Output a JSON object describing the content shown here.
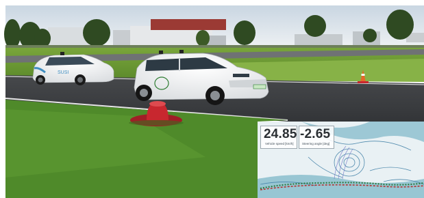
{
  "overlay": {
    "speed": {
      "value": "24.85",
      "label": "Vehicle speed [km/h]"
    },
    "steering": {
      "value": "-2.65",
      "label": "Steering angle [deg]"
    }
  },
  "colors": {
    "sky": "#dfe6ec",
    "grass": "#6c9a34",
    "asphalt": "#3b3d40",
    "car_white": "#f2f3f4",
    "cone_red": "#c8272f",
    "overlay_blue": "#8fc1cf",
    "trajectory_red": "#b3322f",
    "trajectory_green": "#2f7b43"
  }
}
